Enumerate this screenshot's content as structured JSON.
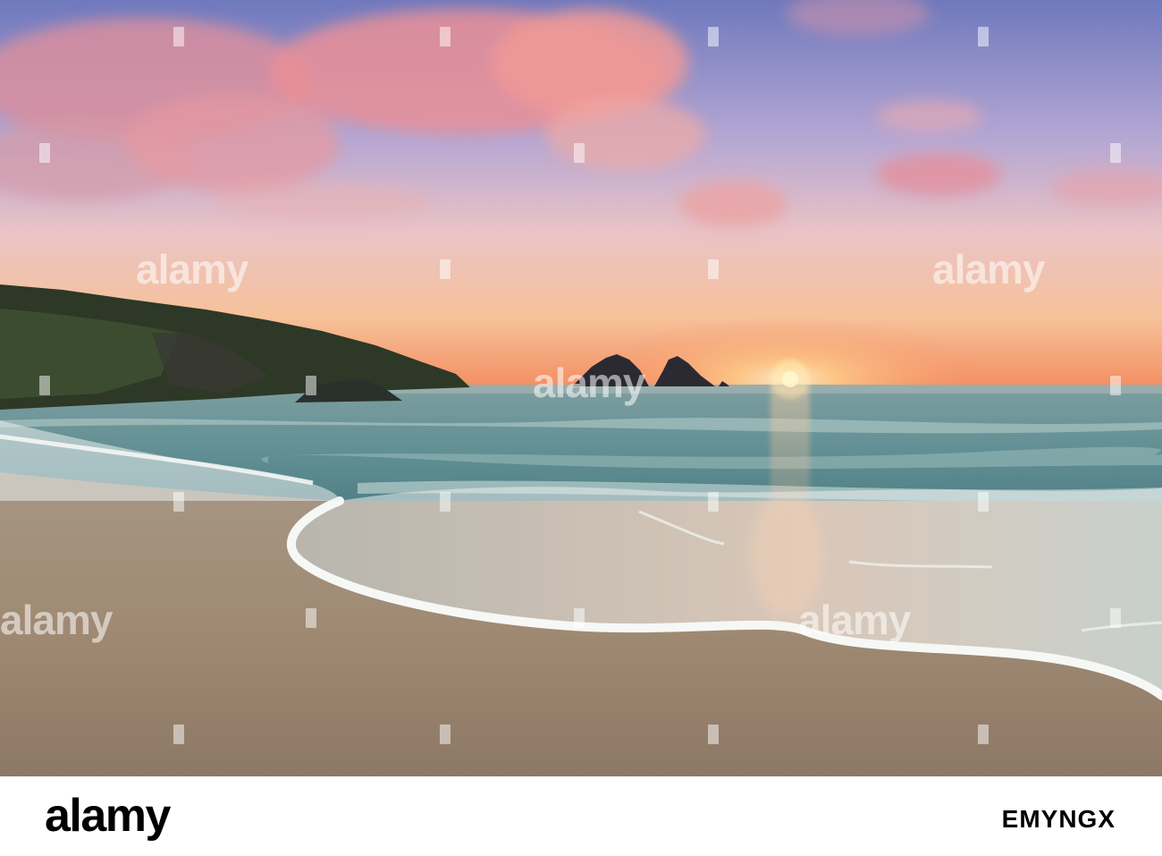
{
  "watermark": {
    "text": "alamy"
  },
  "footer": {
    "logo": "alamy",
    "image_id": "EMYNGX"
  },
  "colors": {
    "sky_top": "#7f86c4",
    "sky_horizon": "#f6a070",
    "cloud": "#e88e97",
    "sea": "#5f8f95",
    "sand": "#a4907c",
    "foam": "#f4f6f4",
    "sun": "#fff2b8",
    "headland": "#2a3524"
  }
}
